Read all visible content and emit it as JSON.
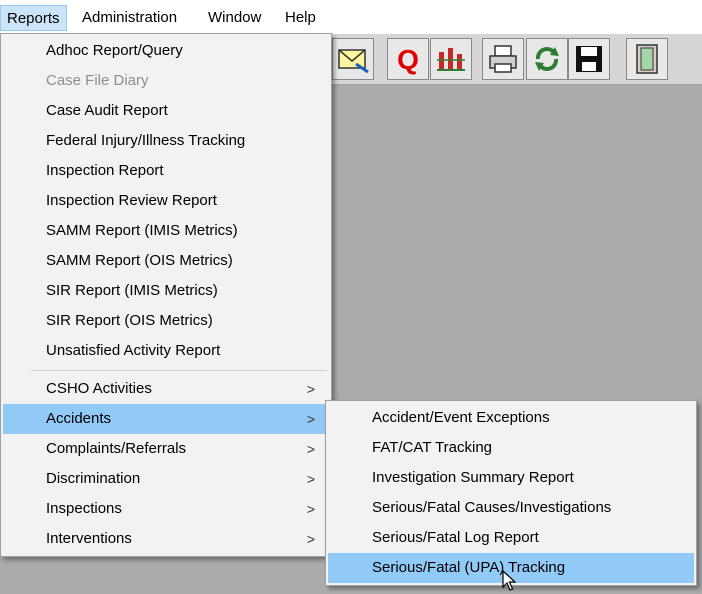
{
  "menubar": {
    "items": [
      "Reports",
      "Administration",
      "Window",
      "Help"
    ]
  },
  "toolbar": {
    "buttons": [
      "envelope-icon",
      "query-icon",
      "chart-icon",
      "printer-icon",
      "refresh-icon",
      "save-icon",
      "exit-door-icon"
    ]
  },
  "reports_menu": {
    "items": [
      {
        "label": "Adhoc Report/Query"
      },
      {
        "label": "Case File Diary",
        "disabled": true
      },
      {
        "label": "Case Audit Report"
      },
      {
        "label": "Federal Injury/Illness Tracking"
      },
      {
        "label": "Inspection Report"
      },
      {
        "label": "Inspection Review Report"
      },
      {
        "label": "SAMM Report (IMIS Metrics)"
      },
      {
        "label": "SAMM Report (OIS Metrics)"
      },
      {
        "label": "SIR Report (IMIS Metrics)"
      },
      {
        "label": "SIR Report (OIS Metrics)"
      },
      {
        "label": "Unsatisfied Activity Report"
      }
    ],
    "submenus": [
      {
        "label": "CSHO Activities",
        "arrow": ">"
      },
      {
        "label": "Accidents",
        "arrow": ">",
        "highlighted": true
      },
      {
        "label": "Complaints/Referrals",
        "arrow": ">"
      },
      {
        "label": "Discrimination",
        "arrow": ">"
      },
      {
        "label": "Inspections",
        "arrow": ">"
      },
      {
        "label": "Interventions",
        "arrow": ">"
      }
    ]
  },
  "accidents_submenu": {
    "items": [
      {
        "label": "Accident/Event Exceptions"
      },
      {
        "label": "FAT/CAT Tracking"
      },
      {
        "label": "Investigation Summary Report"
      },
      {
        "label": "Serious/Fatal Causes/Investigations"
      },
      {
        "label": "Serious/Fatal Log Report"
      },
      {
        "label": "Serious/Fatal (UPA) Tracking",
        "highlighted": true
      }
    ]
  },
  "colors": {
    "highlight": "#91c9f7",
    "menu_bg": "#f2f2f2",
    "workspace": "#ababab",
    "disabled_text": "#8e8e8e"
  }
}
